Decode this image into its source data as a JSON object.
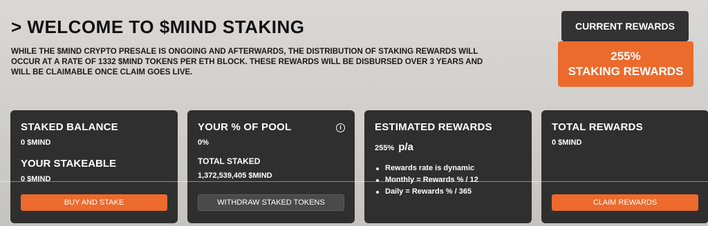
{
  "header": {
    "title": "> WELCOME TO $MIND STAKING",
    "intro": "WHILE THE $MIND CRYPTO PRESALE IS ONGOING AND AFTERWARDS, THE DISTRIBUTION OF STAKING REWARDS WILL OCCUR AT A RATE OF 1332 $MIND TOKENS PER ETH BLOCK. THESE REWARDS WILL BE DISBURSED OVER 3 YEARS AND WILL BE CLAIMABLE ONCE CLAIM GOES LIVE."
  },
  "rewards_panel": {
    "button_label": "CURRENT REWARDS",
    "rate": "255%",
    "rate_label": "STAKING REWARDS"
  },
  "cards": {
    "staked": {
      "title": "STAKED BALANCE",
      "value": "0  $MIND",
      "sub_title": "YOUR STAKEABLE",
      "sub_value": "0  $MIND",
      "button": "BUY AND STAKE"
    },
    "pool": {
      "title": "YOUR % OF POOL",
      "info_glyph": "i",
      "value": "0%",
      "sub_title": "TOTAL STAKED",
      "sub_value": "1,372,539,405  $MIND",
      "button": "WITHDRAW STAKED TOKENS"
    },
    "estimated": {
      "title": "ESTIMATED REWARDS",
      "rate": "255%",
      "rate_unit": "p/a",
      "bullets": [
        "Rewards rate is dynamic",
        "Monthly = Rewards % / 12",
        "Daily = Rewards % / 365"
      ]
    },
    "total": {
      "title": "TOTAL REWARDS",
      "value": "0  $MIND",
      "button": "CLAIM REWARDS"
    }
  },
  "colors": {
    "accent": "#ec6a2c",
    "card_bg": "#2f2f2f",
    "dark_button": "#333333"
  }
}
